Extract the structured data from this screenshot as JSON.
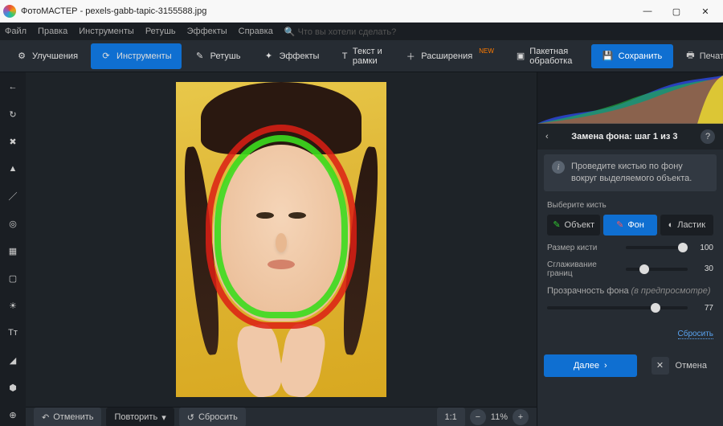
{
  "titlebar": {
    "app": "ФотоМАСТЕР",
    "file": "pexels-gabb-tapic-3155588.jpg"
  },
  "menu": [
    "Файл",
    "Правка",
    "Инструменты",
    "Ретушь",
    "Эффекты",
    "Справка"
  ],
  "menu_search_placeholder": "Что вы хотели сделать?",
  "toolbar": {
    "enhance": "Улучшения",
    "tools": "Инструменты",
    "retouch": "Ретушь",
    "effects": "Эффекты",
    "text": "Текст и рамки",
    "extensions": "Расширения",
    "ext_badge": "NEW",
    "batch": "Пакетная обработка",
    "save": "Сохранить",
    "print": "Печать"
  },
  "statusbar": {
    "undo": "Отменить",
    "redo": "Повторить",
    "reset": "Сбросить",
    "ratio": "1:1",
    "zoom": "11%"
  },
  "panel": {
    "title": "Замена фона: шаг 1 из 3",
    "hint": "Проведите кистью по фону вокруг выделяемого объекта.",
    "brush_label": "Выберите кисть",
    "brush_object": "Объект",
    "brush_bg": "Фон",
    "brush_eraser": "Ластик",
    "size_label": "Размер кисти",
    "size_value": "100",
    "edge_label": "Сглаживание границ",
    "edge_value": "30",
    "opacity_label": "Прозрачность фона",
    "opacity_hint": "(в предпросмотре)",
    "opacity_value": "77",
    "reset": "Сбросить",
    "next": "Далее",
    "cancel": "Отмена"
  }
}
